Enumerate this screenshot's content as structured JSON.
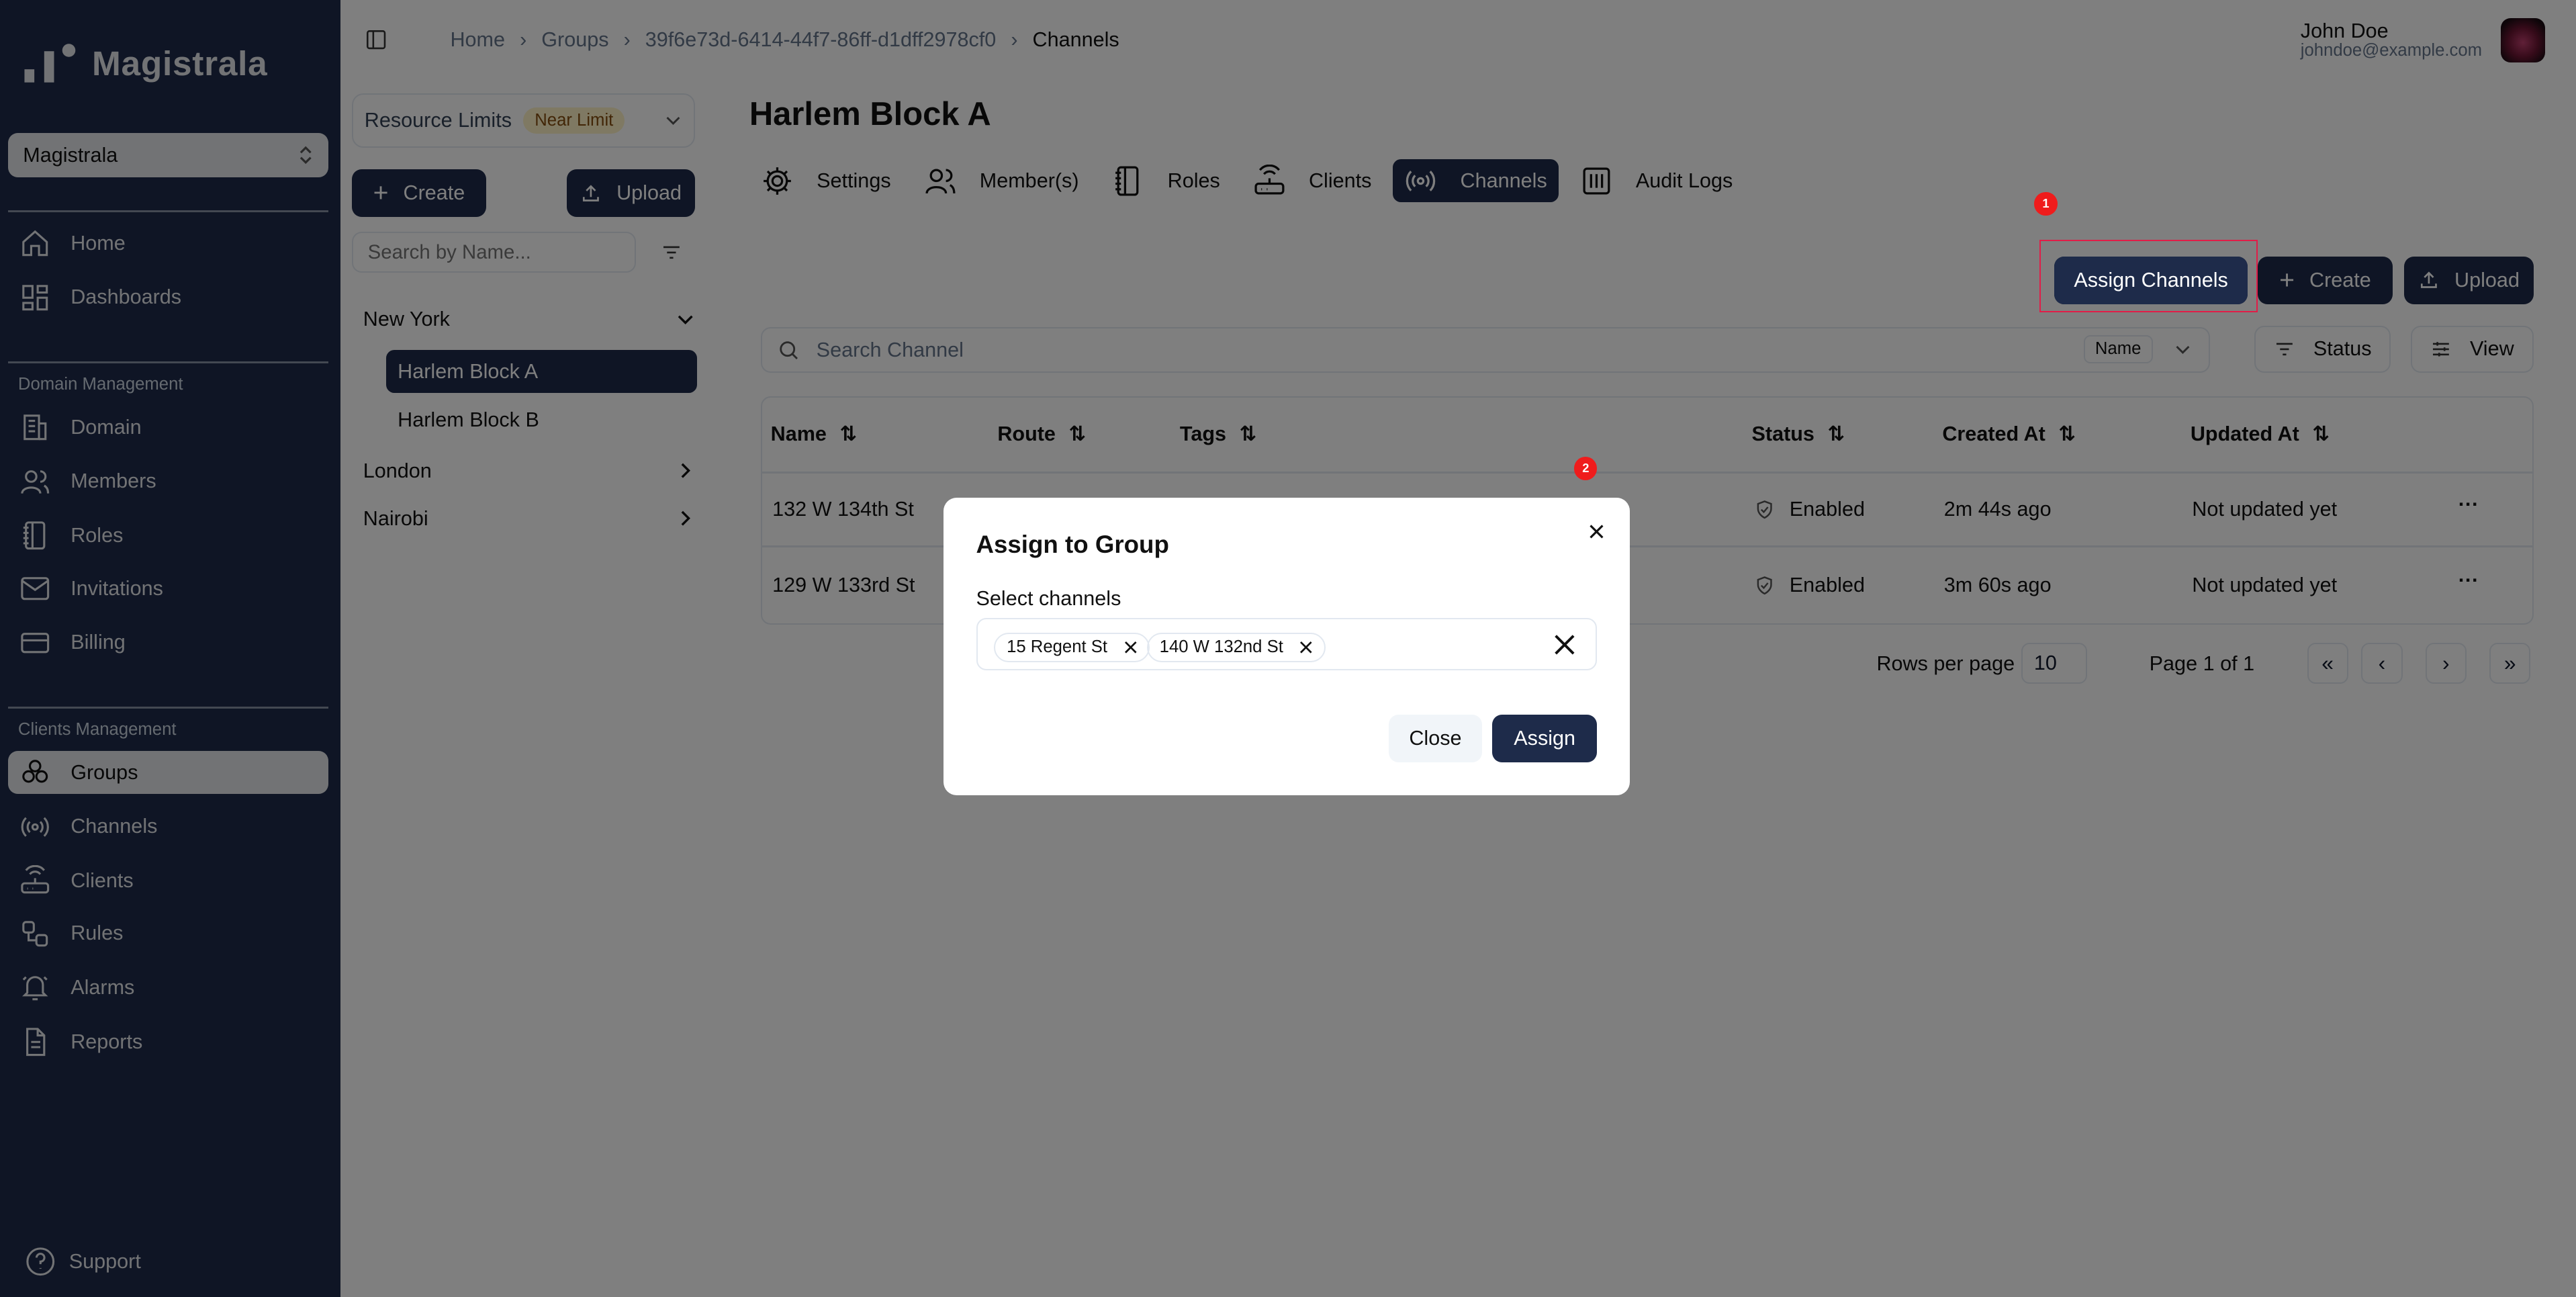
{
  "app": {
    "name": "Magistrala",
    "workspace": "Magistrala"
  },
  "sidebar": {
    "main_items": [
      {
        "label": "Home",
        "icon": "home-icon"
      },
      {
        "label": "Dashboards",
        "icon": "dashboard-icon"
      }
    ],
    "domain_section": "Domain Management",
    "domain_items": [
      {
        "label": "Domain",
        "icon": "building-icon"
      },
      {
        "label": "Members",
        "icon": "users-icon"
      },
      {
        "label": "Roles",
        "icon": "notebook-icon"
      },
      {
        "label": "Invitations",
        "icon": "mail-icon"
      },
      {
        "label": "Billing",
        "icon": "credit-card-icon"
      }
    ],
    "clients_section": "Clients Management",
    "clients_items": [
      {
        "label": "Groups",
        "icon": "groups-icon"
      },
      {
        "label": "Channels",
        "icon": "radio-icon"
      },
      {
        "label": "Clients",
        "icon": "router-icon"
      },
      {
        "label": "Rules",
        "icon": "workflow-icon"
      },
      {
        "label": "Alarms",
        "icon": "bell-icon"
      },
      {
        "label": "Reports",
        "icon": "file-icon"
      }
    ],
    "support": "Support"
  },
  "tree": {
    "resource_limits": "Resource Limits",
    "badge": "Near Limit",
    "create": "Create",
    "upload": "Upload",
    "search_placeholder": "Search by Name...",
    "items": [
      "New York",
      "Harlem Block A",
      "Harlem Block B",
      "London",
      "Nairobi"
    ]
  },
  "breadcrumb": [
    "Home",
    "Groups",
    "39f6e73d-6414-44f7-86ff-d1dff2978cf0",
    "Channels"
  ],
  "user": {
    "name": "John Doe",
    "email": "johndoe@example.com"
  },
  "page": {
    "title": "Harlem Block A",
    "tabs": [
      "Settings",
      "Member(s)",
      "Roles",
      "Clients",
      "Channels",
      "Audit Logs"
    ],
    "active_tab": "Channels",
    "assign_channels": "Assign Channels",
    "create": "Create",
    "upload": "Upload",
    "search_placeholder": "Search Channel",
    "search_field": "Name",
    "status_filter": "Status",
    "view": "View"
  },
  "table": {
    "columns": [
      "Name",
      "Route",
      "Tags",
      "Status",
      "Created At",
      "Updated At"
    ],
    "rows": [
      {
        "name": "132 W 134th St",
        "status": "Enabled",
        "created": "2m 44s ago",
        "updated": "Not updated yet"
      },
      {
        "name": "129 W 133rd St",
        "status": "Enabled",
        "created": "3m 60s ago",
        "updated": "Not updated yet"
      }
    ],
    "rows_per_page_label": "Rows per page",
    "rows_per_page": "10",
    "page_info": "Page 1 of 1"
  },
  "annotations": [
    "1",
    "2"
  ],
  "modal": {
    "title": "Assign to Group",
    "label": "Select channels",
    "chips": [
      "15 Regent St",
      "140 W 132nd St"
    ],
    "close": "Close",
    "assign": "Assign"
  },
  "colors": {
    "sidebar": "#1e2b4a",
    "primary": "#1e2b4a",
    "badge_bg": "#fef3c7",
    "annotation": "#ef1c1c"
  }
}
